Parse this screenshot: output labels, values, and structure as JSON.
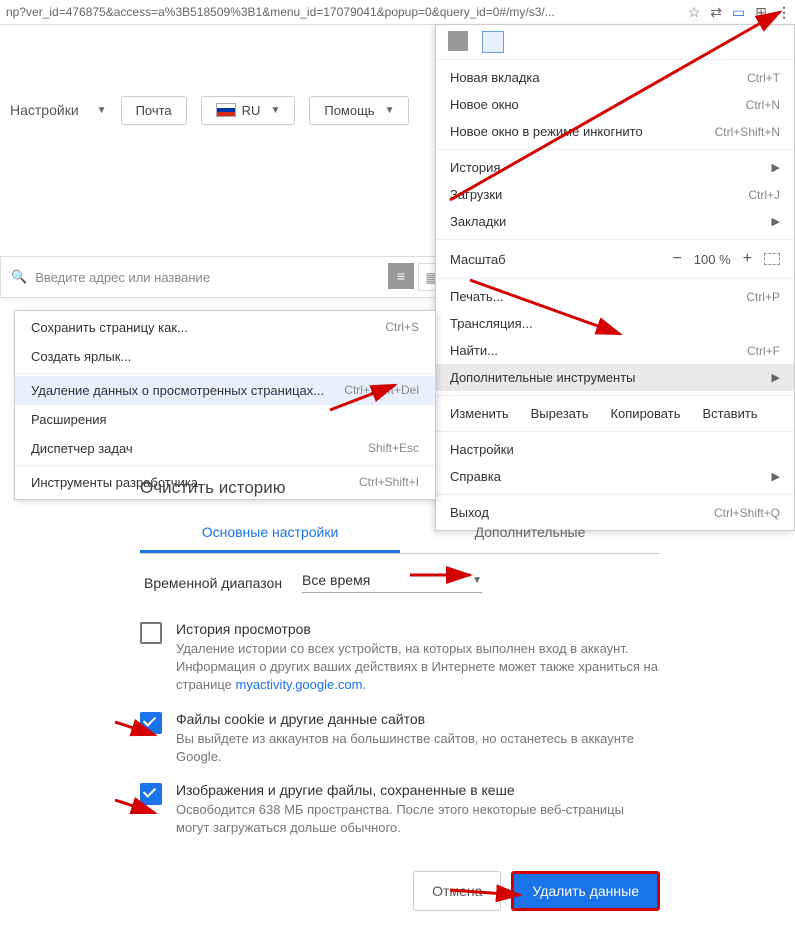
{
  "url_fragment": "np?ver_id=476875&access=a%3B518509%3B1&menu_id=17079041&popup=0&query_id=0#/my/s3/...",
  "toolbar": {
    "settings": "Настройки",
    "mail": "Почта",
    "lang": "RU",
    "help": "Помощь"
  },
  "search_placeholder": "Введите адрес или название",
  "main_menu": {
    "new_tab": {
      "label": "Новая вкладка",
      "sc": "Ctrl+T"
    },
    "new_window": {
      "label": "Новое окно",
      "sc": "Ctrl+N"
    },
    "incognito": {
      "label": "Новое окно в режиме инкогнито",
      "sc": "Ctrl+Shift+N"
    },
    "history": {
      "label": "История"
    },
    "downloads": {
      "label": "Загрузки",
      "sc": "Ctrl+J"
    },
    "bookmarks": {
      "label": "Закладки"
    },
    "zoom": {
      "label": "Масштаб",
      "value": "100 %"
    },
    "print": {
      "label": "Печать...",
      "sc": "Ctrl+P"
    },
    "cast": {
      "label": "Трансляция..."
    },
    "find": {
      "label": "Найти...",
      "sc": "Ctrl+F"
    },
    "more_tools": {
      "label": "Дополнительные инструменты"
    },
    "edit": {
      "label": "Изменить",
      "cut": "Вырезать",
      "copy": "Копировать",
      "paste": "Вставить"
    },
    "settings": {
      "label": "Настройки"
    },
    "help": {
      "label": "Справка"
    },
    "exit": {
      "label": "Выход",
      "sc": "Ctrl+Shift+Q"
    }
  },
  "sub_menu": {
    "save_page": {
      "label": "Сохранить страницу как...",
      "sc": "Ctrl+S"
    },
    "create_shortcut": {
      "label": "Создать ярлык..."
    },
    "clear_data": {
      "label": "Удаление данных о просмотренных страницах...",
      "sc": "Ctrl+Shift+Del"
    },
    "extensions": {
      "label": "Расширения"
    },
    "task_manager": {
      "label": "Диспетчер задач",
      "sc": "Shift+Esc"
    },
    "devtools": {
      "label": "Инструменты разработчика",
      "sc": "Ctrl+Shift+I"
    }
  },
  "dialog": {
    "title": "Очистить историю",
    "tab_basic": "Основные настройки",
    "tab_advanced": "Дополнительные",
    "range_label": "Временной диапазон",
    "range_value": "Все время",
    "opt1": {
      "title": "История просмотров",
      "desc_a": "Удаление истории со всех устройств, на которых выполнен вход в аккаунт. Информация о других ваших действиях в Интернете может также храниться на странице ",
      "link": "myactivity.google.com"
    },
    "opt2": {
      "title": "Файлы cookie и другие данные сайтов",
      "desc": "Вы выйдете из аккаунтов на большинстве сайтов, но останетесь в аккаунте Google."
    },
    "opt3": {
      "title": "Изображения и другие файлы, сохраненные в кеше",
      "desc": "Освободится 638 МБ пространства. После этого некоторые веб-страницы могут загружаться дольше обычного."
    },
    "cancel": "Отмена",
    "clear": "Удалить данные"
  }
}
